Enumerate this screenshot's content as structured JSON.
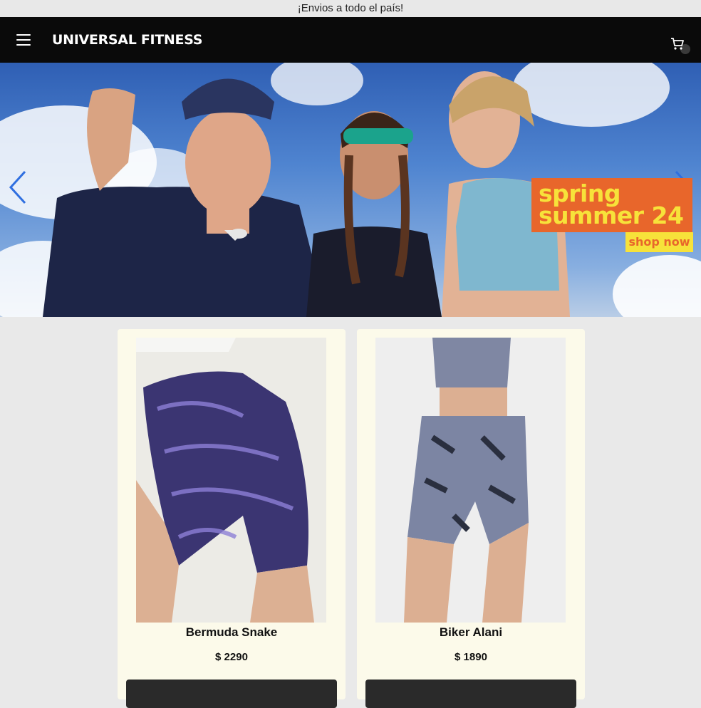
{
  "announcement": "¡Envios a todo el país!",
  "header": {
    "brand": "UNIVERSAL FITNESS",
    "menu_icon": "hamburger-menu-icon",
    "cart_icon": "shopping-cart-icon"
  },
  "hero": {
    "promo_line1": "spring",
    "promo_line2": "summer 24",
    "promo_cta": "shop now",
    "colors": {
      "promo_bg": "#e8662b",
      "promo_text": "#f7e23a",
      "arrow": "#2f6fe0"
    }
  },
  "products": [
    {
      "name": "Bermuda Snake",
      "price": "$ 2290"
    },
    {
      "name": "Biker Alani",
      "price": "$ 1890"
    }
  ]
}
